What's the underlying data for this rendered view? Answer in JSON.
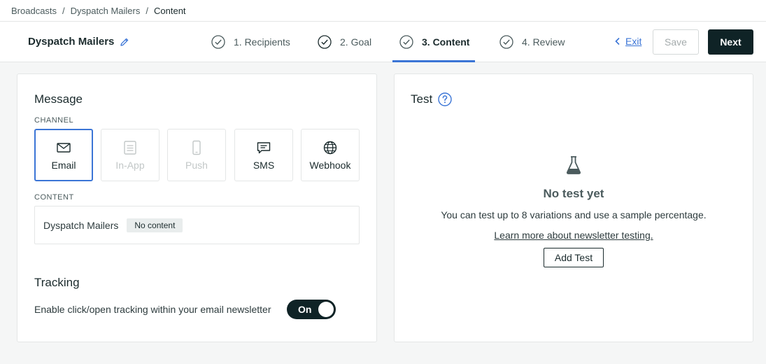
{
  "breadcrumb": {
    "items": [
      "Broadcasts",
      "Dyspatch Mailers",
      "Content"
    ],
    "separator": "/"
  },
  "header": {
    "campaign_name": "Dyspatch Mailers",
    "steps": [
      {
        "label": "1. Recipients",
        "state": "complete"
      },
      {
        "label": "2. Goal",
        "state": "complete"
      },
      {
        "label": "3. Content",
        "state": "active"
      },
      {
        "label": "4. Review",
        "state": "complete"
      }
    ],
    "exit_label": "Exit",
    "save_label": "Save",
    "next_label": "Next"
  },
  "message": {
    "title": "Message",
    "channel_label": "CHANNEL",
    "channels": [
      {
        "label": "Email",
        "icon": "envelope-icon",
        "state": "selected"
      },
      {
        "label": "In-App",
        "icon": "in-app-icon",
        "state": "disabled"
      },
      {
        "label": "Push",
        "icon": "phone-icon",
        "state": "disabled"
      },
      {
        "label": "SMS",
        "icon": "chat-icon",
        "state": "enabled"
      },
      {
        "label": "Webhook",
        "icon": "globe-icon",
        "state": "enabled"
      }
    ],
    "content_label": "CONTENT",
    "content_name": "Dyspatch Mailers",
    "content_badge": "No content"
  },
  "tracking": {
    "title": "Tracking",
    "description": "Enable click/open tracking within your email newsletter",
    "toggle_label": "On",
    "enabled": true
  },
  "test": {
    "title": "Test",
    "empty_title": "No test yet",
    "empty_description": "You can test up to 8 variations and use a sample percentage.",
    "learn_more": "Learn more about newsletter testing.",
    "add_button": "Add Test"
  },
  "colors": {
    "accent": "#3b75d6",
    "primary_dark": "#0f2326",
    "background": "#f5f6f6"
  }
}
